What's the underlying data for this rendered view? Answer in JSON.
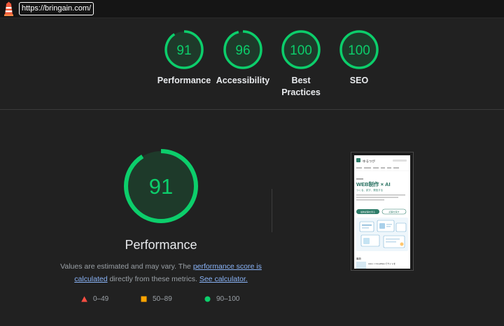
{
  "url": "https://bringain.com/",
  "colors": {
    "pass": "#0cce6b",
    "average": "#ffa400",
    "fail": "#ff4e42",
    "link": "#8ab4f8"
  },
  "summary": [
    {
      "score": "91",
      "label": "Performance",
      "fraction": 0.91
    },
    {
      "score": "96",
      "label": "Accessibility",
      "fraction": 0.96
    },
    {
      "score": "100",
      "label": "Best\nPractices",
      "fraction": 1.0
    },
    {
      "score": "100",
      "label": "SEO",
      "fraction": 1.0
    }
  ],
  "main": {
    "score": "91",
    "fraction": 0.91,
    "title": "Performance",
    "desc_prefix": "Values are estimated and may vary. The",
    "desc_link1": "performance score is calculated",
    "desc_middle": "directly from these metrics.",
    "desc_link2": "See calculator."
  },
  "legend": [
    {
      "range": "0–49",
      "icon": "triangle-icon",
      "color": "#ff4e42"
    },
    {
      "range": "50–89",
      "icon": "square-icon",
      "color": "#ffa400"
    },
    {
      "range": "90–100",
      "icon": "circle-icon",
      "color": "#0cce6b"
    }
  ],
  "thumbnail": {
    "site_name": "ゆるつが",
    "heading": "WEB制作 × AI",
    "subheading": "つくる、試す、発信する",
    "btn_primary": "最新記事を見る",
    "btn_secondary": "記事を探す",
    "section_label": "最新",
    "article_title": "Astro × Cloudflareでサイトを"
  }
}
